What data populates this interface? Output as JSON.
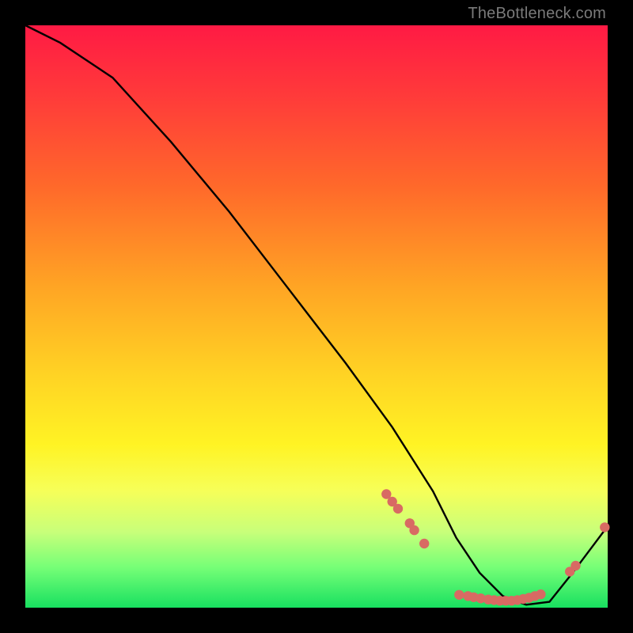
{
  "watermark": "TheBottleneck.com",
  "chart_data": {
    "type": "line",
    "title": "",
    "xlabel": "",
    "ylabel": "",
    "xlim": [
      0,
      100
    ],
    "ylim": [
      0,
      100
    ],
    "series": [
      {
        "name": "curve",
        "x": [
          0,
          6,
          15,
          25,
          35,
          45,
          55,
          63,
          70,
          74,
          78,
          82,
          86,
          90,
          94,
          100
        ],
        "y": [
          100,
          97,
          91,
          80,
          68,
          55,
          42,
          31,
          20,
          12,
          6,
          2,
          0.5,
          1,
          6,
          14
        ]
      }
    ],
    "markers": [
      {
        "x": 62,
        "y": 19.5
      },
      {
        "x": 63,
        "y": 18.2
      },
      {
        "x": 64,
        "y": 17.0
      },
      {
        "x": 66,
        "y": 14.5
      },
      {
        "x": 66.8,
        "y": 13.3
      },
      {
        "x": 68.5,
        "y": 11.0
      },
      {
        "x": 74.5,
        "y": 2.2
      },
      {
        "x": 76,
        "y": 2.0
      },
      {
        "x": 77,
        "y": 1.8
      },
      {
        "x": 78.2,
        "y": 1.6
      },
      {
        "x": 79.5,
        "y": 1.4
      },
      {
        "x": 80.5,
        "y": 1.3
      },
      {
        "x": 81.5,
        "y": 1.2
      },
      {
        "x": 82.5,
        "y": 1.2
      },
      {
        "x": 83.5,
        "y": 1.2
      },
      {
        "x": 84.5,
        "y": 1.3
      },
      {
        "x": 85.5,
        "y": 1.5
      },
      {
        "x": 86.5,
        "y": 1.7
      },
      {
        "x": 87.5,
        "y": 2.0
      },
      {
        "x": 88.5,
        "y": 2.3
      },
      {
        "x": 93.5,
        "y": 6.2
      },
      {
        "x": 94.5,
        "y": 7.2
      },
      {
        "x": 99.5,
        "y": 13.8
      }
    ],
    "colors": {
      "curve": "#000000",
      "marker": "#d86a63"
    }
  }
}
